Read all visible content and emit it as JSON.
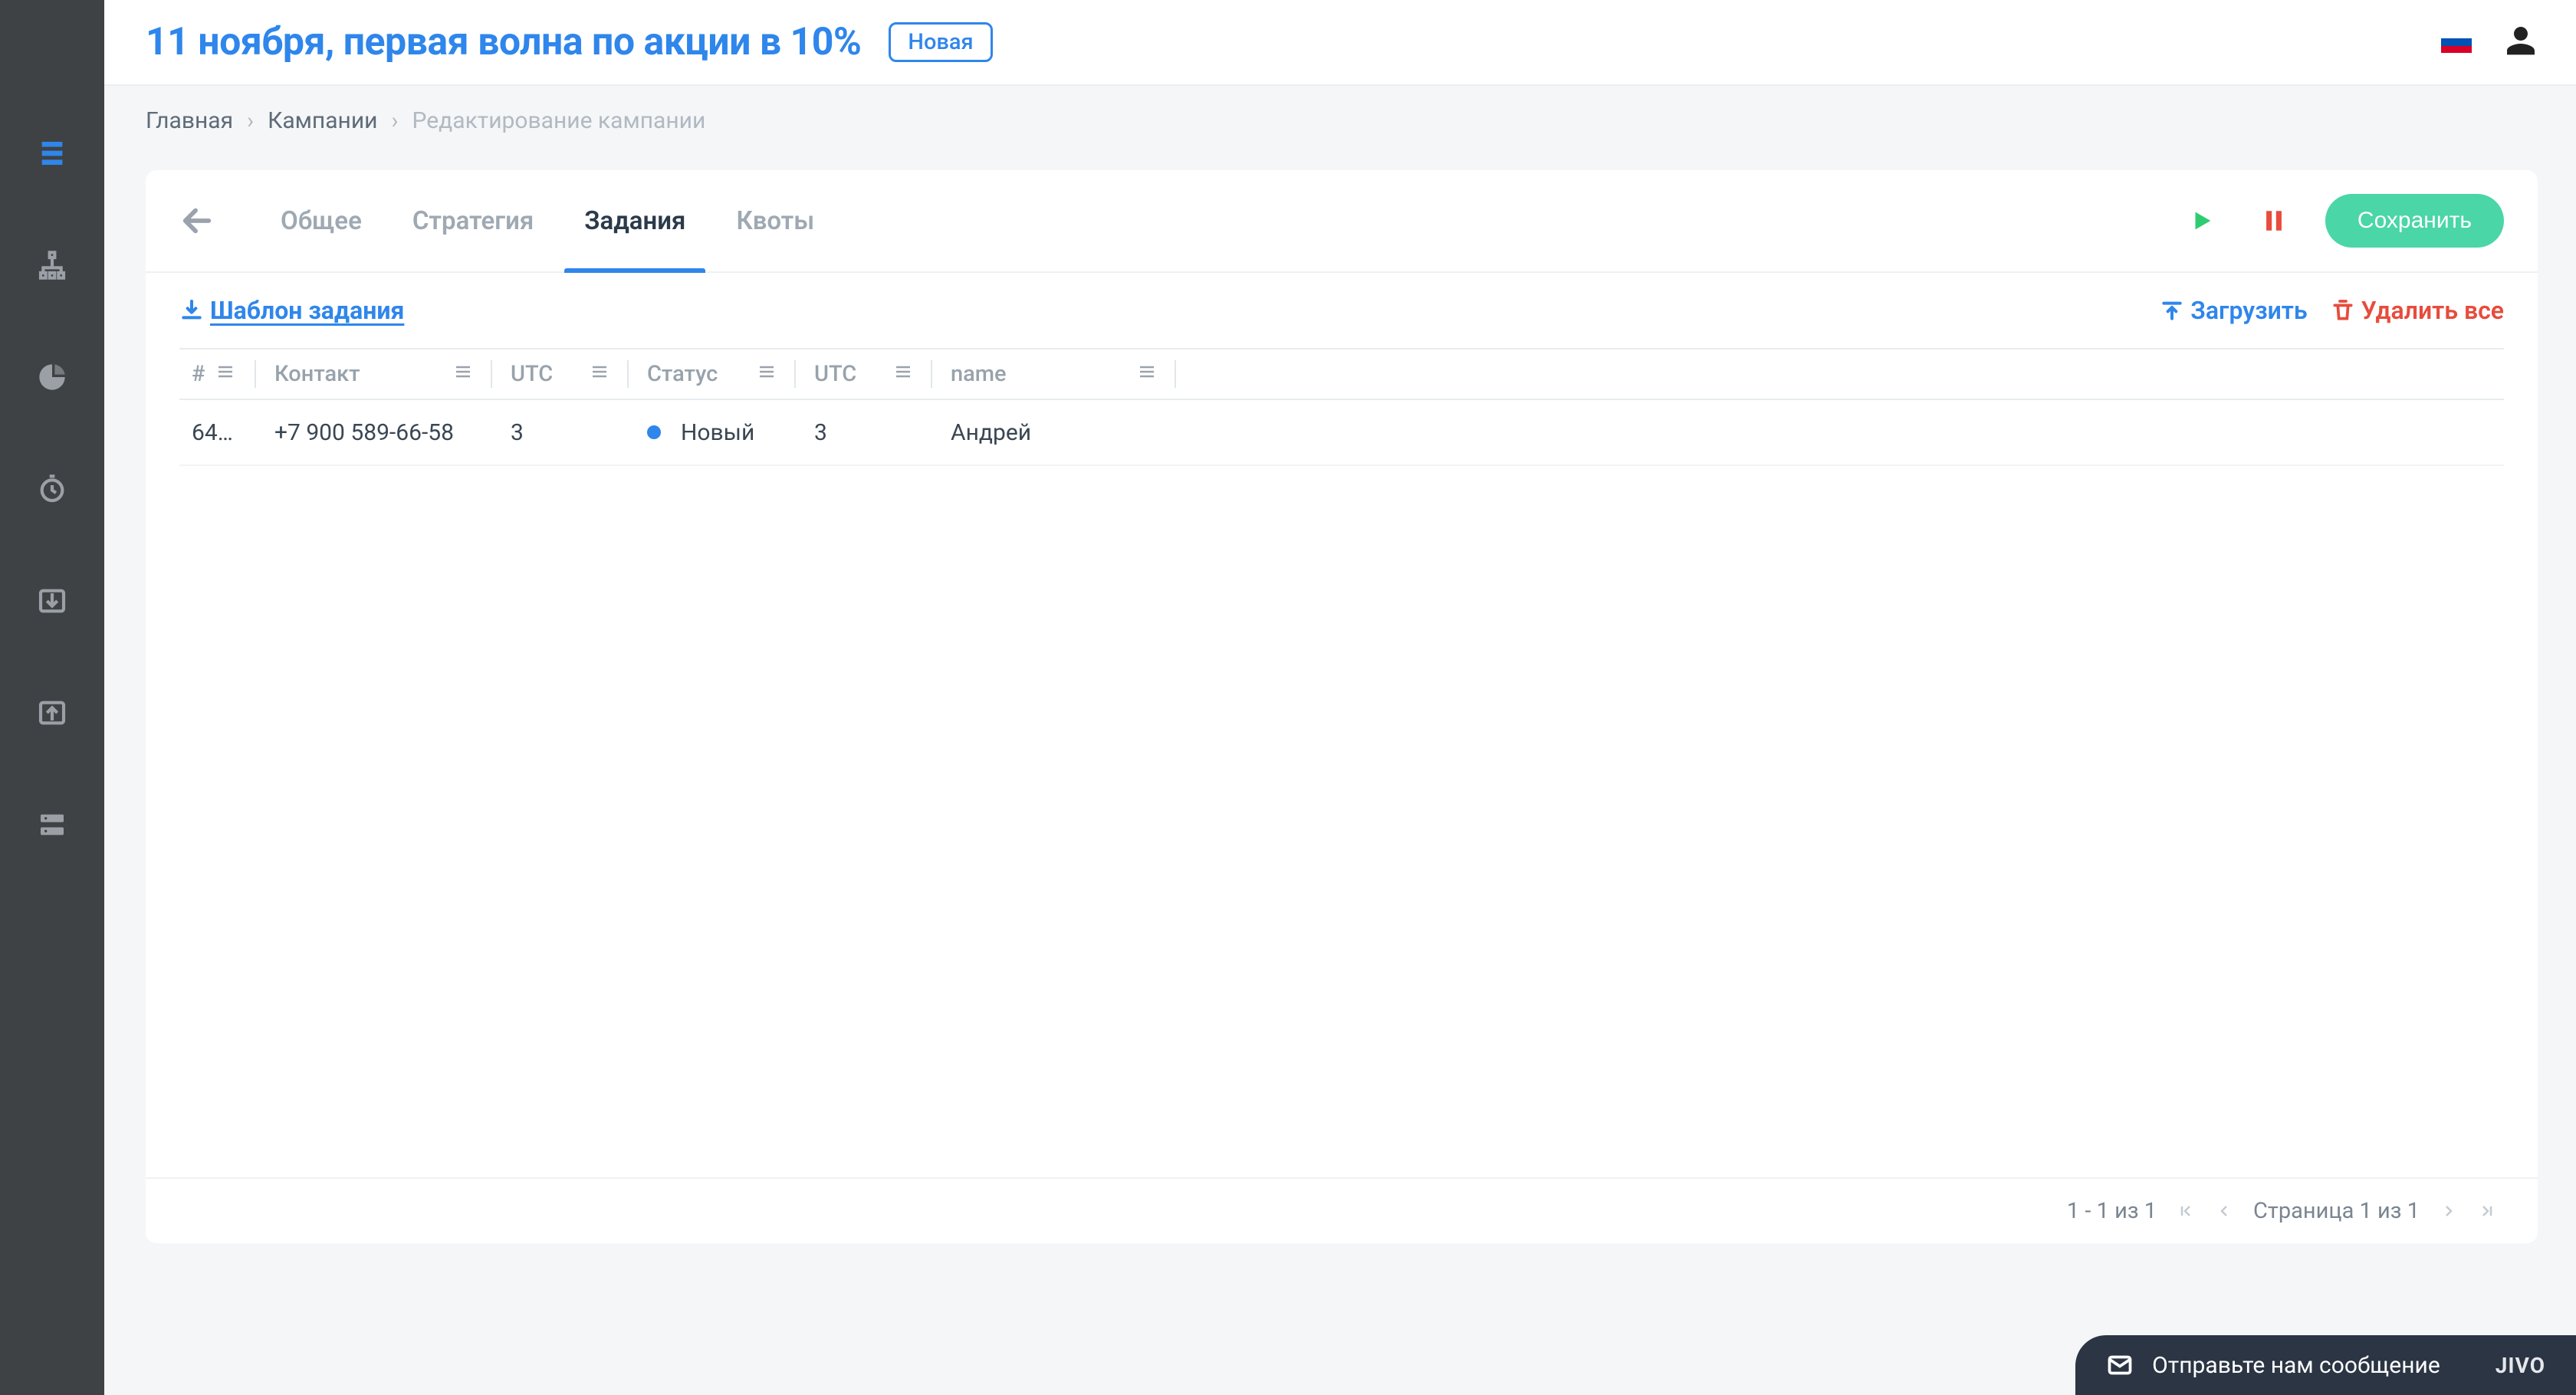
{
  "header": {
    "title": "11 ноября, первая волна по акции в 10%",
    "status_badge": "Новая"
  },
  "breadcrumb": {
    "home": "Главная",
    "campaigns": "Кампании",
    "current": "Редактирование кампании"
  },
  "tabs": {
    "general": "Общее",
    "strategy": "Стратегия",
    "tasks": "Задания",
    "quotas": "Квоты",
    "save": "Сохранить"
  },
  "toolbar": {
    "template": "Шаблон задания",
    "upload": "Загрузить",
    "delete_all": "Удалить все"
  },
  "table": {
    "columns": {
      "id": "#",
      "contact": "Контакт",
      "utc1": "UTC",
      "status": "Статус",
      "utc2": "UTC",
      "name": "name"
    },
    "rows": [
      {
        "id": "64…",
        "contact": "+7 900 589-66-58",
        "utc1": "3",
        "status": "Новый",
        "status_color": "#2f86eb",
        "utc2": "3",
        "name": "Андрей"
      }
    ]
  },
  "pagination": {
    "range": "1 - 1 из 1",
    "page": "Страница 1 из 1"
  },
  "jivo": {
    "text": "Отправьте нам сообщение",
    "brand": "JIVO"
  }
}
